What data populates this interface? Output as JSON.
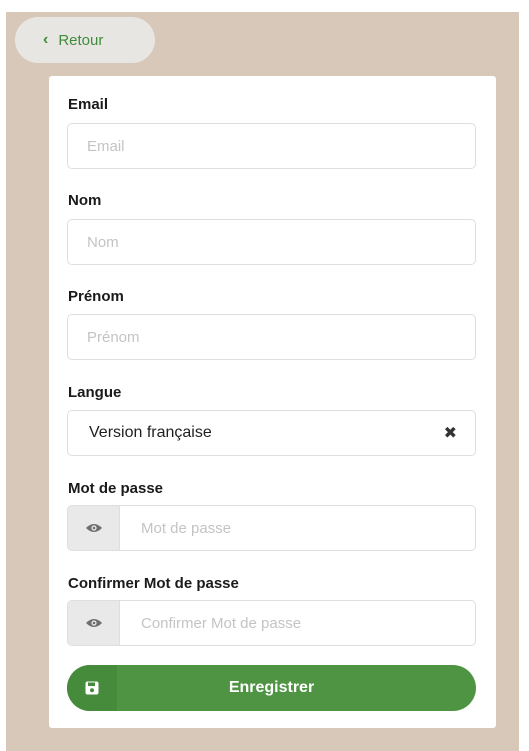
{
  "back": {
    "label": "Retour",
    "icon": "chevron-left-icon"
  },
  "form": {
    "email": {
      "label": "Email",
      "placeholder": "Email",
      "value": ""
    },
    "nom": {
      "label": "Nom",
      "placeholder": "Nom",
      "value": ""
    },
    "prenom": {
      "label": "Prénom",
      "placeholder": "Prénom",
      "value": ""
    },
    "langue": {
      "label": "Langue",
      "value": "Version française",
      "clear_icon": "close-icon"
    },
    "password": {
      "label": "Mot de passe",
      "placeholder": "Mot de passe",
      "icon": "eye-icon"
    },
    "confirm": {
      "label": "Confirmer Mot de passe",
      "placeholder": "Confirmer Mot de passe",
      "icon": "eye-icon"
    }
  },
  "save": {
    "label": "Enregistrer",
    "icon": "save-icon"
  },
  "colors": {
    "background": "#d8c8b9",
    "accent": "#4f9443",
    "back_text": "#3f8c3a"
  }
}
